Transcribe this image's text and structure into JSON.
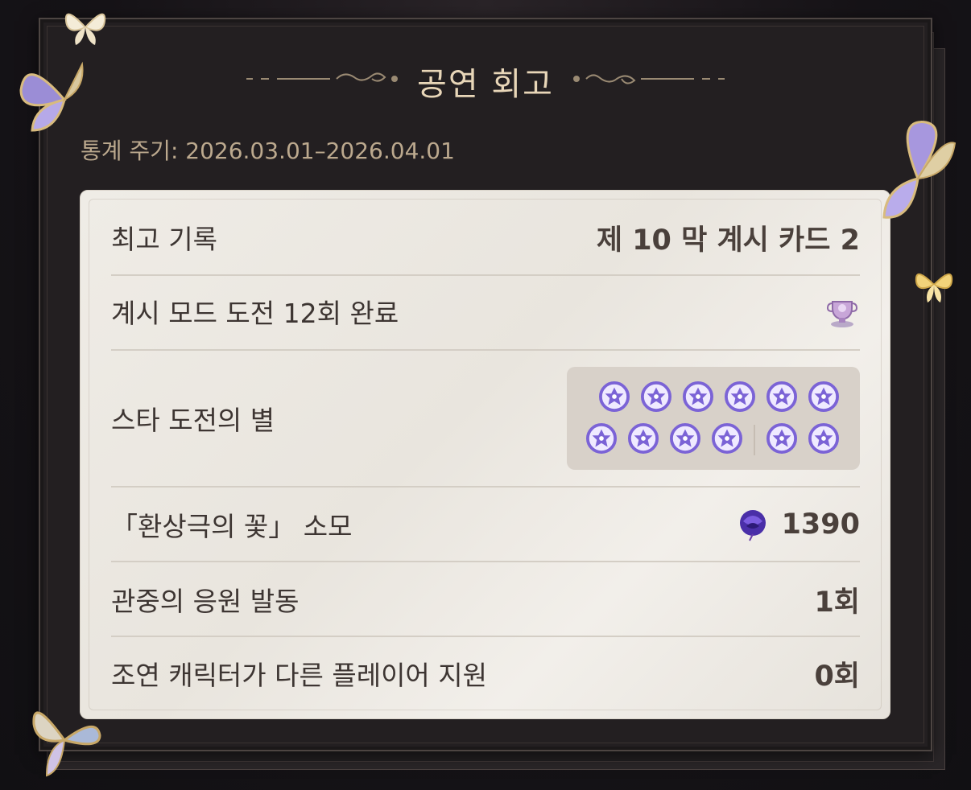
{
  "header": {
    "title": "공연 회고"
  },
  "period": {
    "text": "통계 주기: 2026.03.01–2026.04.01"
  },
  "rows": {
    "best_record": {
      "label": "최고 기록",
      "value": "제 10 막  계시 카드 2"
    },
    "challenge": {
      "label": "계시 모드 도전 12회 완료",
      "icon": "trophy-icon"
    },
    "stars": {
      "label": "스타 도전의 별",
      "filled": 12,
      "total": 12,
      "icon": "star-badge-icon"
    },
    "flower": {
      "label": "「환상극의 꽃」 소모",
      "value": "1390",
      "icon": "purple-rose-icon"
    },
    "cheer": {
      "label": "관중의 응원 발동",
      "value": "1회"
    },
    "support": {
      "label": "조연 캐릭터가 다른 플레이어 지원",
      "value": "0회"
    }
  },
  "colors": {
    "panel": "#231f21",
    "card": "#efece6",
    "title": "#e8d6b8",
    "label": "#3d3532",
    "star": "#7b63d6"
  }
}
